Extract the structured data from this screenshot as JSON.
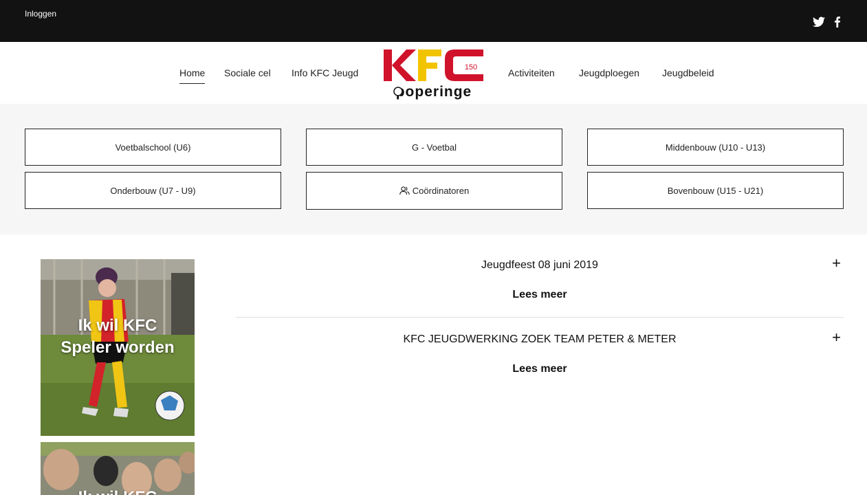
{
  "topbar": {
    "login_label": "Inloggen",
    "social": [
      "twitter-icon",
      "facebook-icon"
    ]
  },
  "nav": {
    "left": [
      "Home",
      "Sociale cel",
      "Info KFC Jeugd"
    ],
    "right": [
      "Activiteiten",
      "Jeugdploegen",
      "Jeugdbeleid"
    ],
    "active": "Home"
  },
  "logo": {
    "line1": "KFC",
    "badge": "150",
    "line2": "poperinge",
    "colors": {
      "red": "#d0122b",
      "yellow": "#f2c400",
      "black": "#111111"
    }
  },
  "subnav": {
    "row1": [
      "Voetbalschool (U6)",
      "G - Voetbal",
      "Middenbouw (U10 - U13)"
    ],
    "row2": [
      "Onderbouw (U7 - U9)",
      "Coördinatoren",
      "Bovenbouw (U15 - U21)"
    ]
  },
  "tiles": [
    {
      "text": "Ik wil KFC Speler worden"
    },
    {
      "text": "Ik wil KFC"
    }
  ],
  "articles": [
    {
      "title": "Jeugdfeest 08 juni 2019",
      "more": "Lees meer",
      "toggle": "+"
    },
    {
      "title": "KFC JEUGDWERKING ZOEK TEAM PETER & METER",
      "more": "Lees meer",
      "toggle": "+"
    }
  ]
}
